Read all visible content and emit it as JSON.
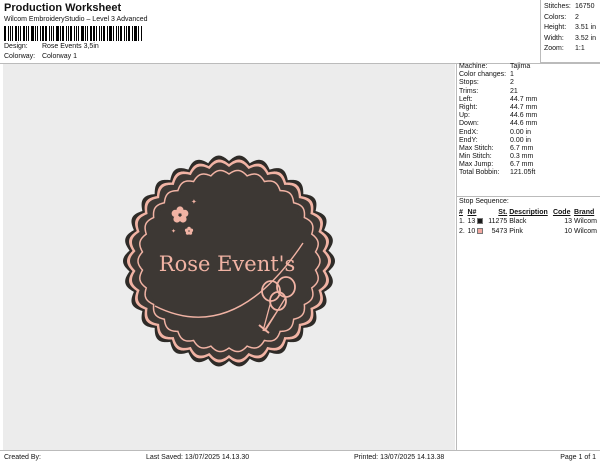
{
  "header": {
    "title": "Production Worksheet",
    "subtitle": "Wilcom EmbroideryStudio – Level 3 Advanced",
    "design_label": "Design:",
    "design_value": "Rose Events 3,5in",
    "colorway_label": "Colorway:",
    "colorway_value": "Colorway 1"
  },
  "summary": [
    {
      "label": "Stitches:",
      "value": "16750"
    },
    {
      "label": "Colors:",
      "value": "2"
    },
    {
      "label": "Height:",
      "value": "3.51 in"
    },
    {
      "label": "Width:",
      "value": "3.52 in"
    },
    {
      "label": "Zoom:",
      "value": "1:1"
    }
  ],
  "details": [
    {
      "label": "Machine:",
      "value": "Tajima"
    },
    {
      "label": "Color changes:",
      "value": "1"
    },
    {
      "label": "Stops:",
      "value": "2"
    },
    {
      "label": "Trims:",
      "value": "21"
    },
    {
      "label": "Left:",
      "value": "44.7 mm"
    },
    {
      "label": "Right:",
      "value": "44.7 mm"
    },
    {
      "label": "Up:",
      "value": "44.6 mm"
    },
    {
      "label": "Down:",
      "value": "44.6 mm"
    },
    {
      "label": "EndX:",
      "value": "0.00 in"
    },
    {
      "label": "EndY:",
      "value": "0.00 in"
    },
    {
      "label": "Max Stitch:",
      "value": "6.7 mm"
    },
    {
      "label": "Min Stitch:",
      "value": "0.3 mm"
    },
    {
      "label": "Max Jump:",
      "value": "6.7 mm"
    },
    {
      "label": "Total Bobbin:",
      "value": "121.05ft"
    }
  ],
  "stop_sequence": {
    "title": "Stop Sequence:",
    "headers": [
      "#",
      "N#",
      "St.",
      "Description",
      "Code",
      "Brand"
    ],
    "rows": [
      {
        "idx": "1.",
        "needle": "13",
        "color": "#1a1a1a",
        "stitches": "11275",
        "description": "Black",
        "code": "13",
        "brand": "Wilcom"
      },
      {
        "idx": "2.",
        "needle": "10",
        "color": "#f2a7a0",
        "stitches": "5473",
        "description": "Pink",
        "code": "10",
        "brand": "Wilcom"
      }
    ]
  },
  "design": {
    "text": "Rose Event's",
    "fill_color": "#3d3834",
    "accent_color": "#f1b3a4",
    "background_color": "#ececec"
  },
  "footer": {
    "created_by": "Created By:",
    "last_saved": "Last Saved: 13/07/2025 14.13.30",
    "printed": "Printed: 13/07/2025 14.13.38",
    "page": "Page 1 of 1"
  }
}
